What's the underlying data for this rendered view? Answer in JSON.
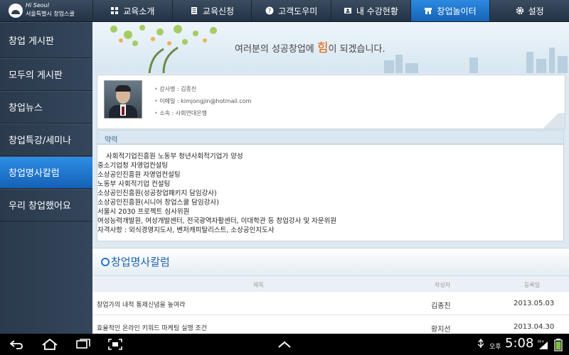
{
  "logo": {
    "brand": "Hi Seoul",
    "org": "서울특별시 창업스쿨"
  },
  "nav": {
    "tabs": [
      {
        "label": "교육소개",
        "icon": "grid-icon"
      },
      {
        "label": "교육신청",
        "icon": "document-icon"
      },
      {
        "label": "고객도우미",
        "icon": "question-icon"
      },
      {
        "label": "내 수강현황",
        "icon": "id-card-icon"
      },
      {
        "label": "창업놀이터",
        "icon": "store-icon",
        "active": true
      },
      {
        "label": "설정",
        "icon": "gear-icon"
      }
    ]
  },
  "sidebar": {
    "items": [
      {
        "label": "창업 게시판"
      },
      {
        "label": "모두의 게시판"
      },
      {
        "label": "창업뉴스"
      },
      {
        "label": "창업특강/세미나"
      },
      {
        "label": "창업명사칼럼",
        "active": true
      },
      {
        "label": "우리 창업했어요"
      }
    ]
  },
  "banner": {
    "message_before": "여러분의 성공창업에 ",
    "highlight": "힘",
    "message_after": "이 되겠습니다."
  },
  "profile": {
    "name": "강사명 : 김종진",
    "email": "이메일 : kimjongjin@hotmail.com",
    "affiliation": "소속 : 사회연대은행"
  },
  "career": {
    "heading": "약력",
    "lines": [
      "사회적기업진흥원 노동부 청년사회적기업가 양성",
      "중소기업청 자영업컨설팅",
      "소상공인진흥원 자영업컨설팅",
      "노동부 사회적기업 컨설팅",
      "소상공인진흥원(성공창업패키지 담임강사)",
      "소상공인진흥원(시니어 창업스쿨 담임강사)",
      "서울시 2030 프로젝트 심사위원",
      "여성능력개발원, 여성개발센터, 전국광역자활센터, 이대학관 등 창업강사 및 자문위원",
      "자격사항 : 외식경영지도사, 벤처캐피탈리스트, 소상공인지도사"
    ]
  },
  "column_list": {
    "title": "창업명사칼럼",
    "headers": {
      "title": "제목",
      "author": "작성자",
      "date": "등록일"
    },
    "rows": [
      {
        "title": "창업가의 내적 통제신념을 높여라",
        "author": "김종진",
        "date": "2013.05.03"
      },
      {
        "title": "효율적인 온라인 키워드 마케팅 실행 조건",
        "author": "황지선",
        "date": "2013.04.30"
      }
    ]
  },
  "system_bar": {
    "ampm": "오후",
    "time": "5:08"
  },
  "colors": {
    "active_blue": "#1f78d1",
    "sidebar_dark": "#2e3e52",
    "accent_orange": "#e55a00"
  }
}
